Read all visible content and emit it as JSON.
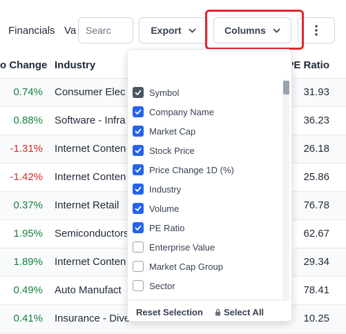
{
  "toolbar": {
    "tab_financials": "Financials",
    "tab_partial": "Va",
    "search_placeholder": "Searc",
    "export_label": "Export",
    "columns_label": "Columns"
  },
  "table": {
    "headers": {
      "change": "o Change",
      "industry": "Industry",
      "pe": "PE Ratio"
    },
    "rows": [
      {
        "change": "0.74%",
        "industry": "Consumer Elec",
        "pe": "31.93",
        "dir": "pos"
      },
      {
        "change": "0.88%",
        "industry": "Software - Infra",
        "pe": "36.23",
        "dir": "pos"
      },
      {
        "change": "-1.31%",
        "industry": "Internet Conten",
        "pe": "26.18",
        "dir": "neg"
      },
      {
        "change": "-1.42%",
        "industry": "Internet Conten",
        "pe": "25.86",
        "dir": "neg"
      },
      {
        "change": "0.37%",
        "industry": "Internet Retail",
        "pe": "76.78",
        "dir": "pos"
      },
      {
        "change": "1.95%",
        "industry": "Semiconductors",
        "pe": "62.67",
        "dir": "pos"
      },
      {
        "change": "1.89%",
        "industry": "Internet Conten",
        "pe": "29.34",
        "dir": "pos"
      },
      {
        "change": "0.49%",
        "industry": "Auto Manufact",
        "pe": "78.41",
        "dir": "pos"
      },
      {
        "change": "0.41%",
        "industry": "Insurance - Diversified",
        "pe": "10.25",
        "dir": "pos"
      }
    ]
  },
  "dropdown": {
    "items": [
      {
        "label": "Symbol",
        "state": "dark"
      },
      {
        "label": "Company Name",
        "state": "checked"
      },
      {
        "label": "Market Cap",
        "state": "checked"
      },
      {
        "label": "Stock Price",
        "state": "checked"
      },
      {
        "label": "Price Change 1D (%)",
        "state": "checked"
      },
      {
        "label": "Industry",
        "state": "checked"
      },
      {
        "label": "Volume",
        "state": "checked"
      },
      {
        "label": "PE Ratio",
        "state": "checked"
      },
      {
        "label": "Enterprise Value",
        "state": "unchecked"
      },
      {
        "label": "Market Cap Group",
        "state": "unchecked"
      },
      {
        "label": "Sector",
        "state": "unchecked"
      }
    ],
    "reset_label": "Reset Selection",
    "select_all_label": "Select All"
  },
  "colors": {
    "accent": "#2563eb",
    "highlight": "#e0262b",
    "positive": "#15803d",
    "negative": "#dc2626"
  }
}
